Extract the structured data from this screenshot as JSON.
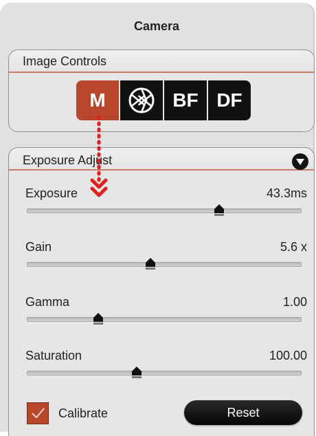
{
  "panel": {
    "title": "Camera"
  },
  "image_controls": {
    "label": "Image Controls",
    "modes": [
      {
        "label": "M",
        "active": true
      },
      {
        "label": "",
        "icon": "aperture-icon",
        "active": false
      },
      {
        "label": "BF",
        "active": false
      },
      {
        "label": "DF",
        "active": false
      }
    ]
  },
  "exposure_adjust": {
    "label": "Exposure Adjust",
    "collapse_icon": "chevron-down-icon",
    "sliders": [
      {
        "label": "Exposure",
        "value": "43.3ms",
        "level": 0.7
      },
      {
        "label": "Gain",
        "value": "5.6 x",
        "level": 0.45
      },
      {
        "label": "Gamma",
        "value": "1.00",
        "level": 0.26
      },
      {
        "label": "Saturation",
        "value": "100.00",
        "level": 0.4
      }
    ],
    "calibrate": {
      "label": "Calibrate",
      "checked": true
    },
    "reset_label": "Reset"
  },
  "colors": {
    "accent": "#b9462b",
    "annotation": "#e02020"
  }
}
